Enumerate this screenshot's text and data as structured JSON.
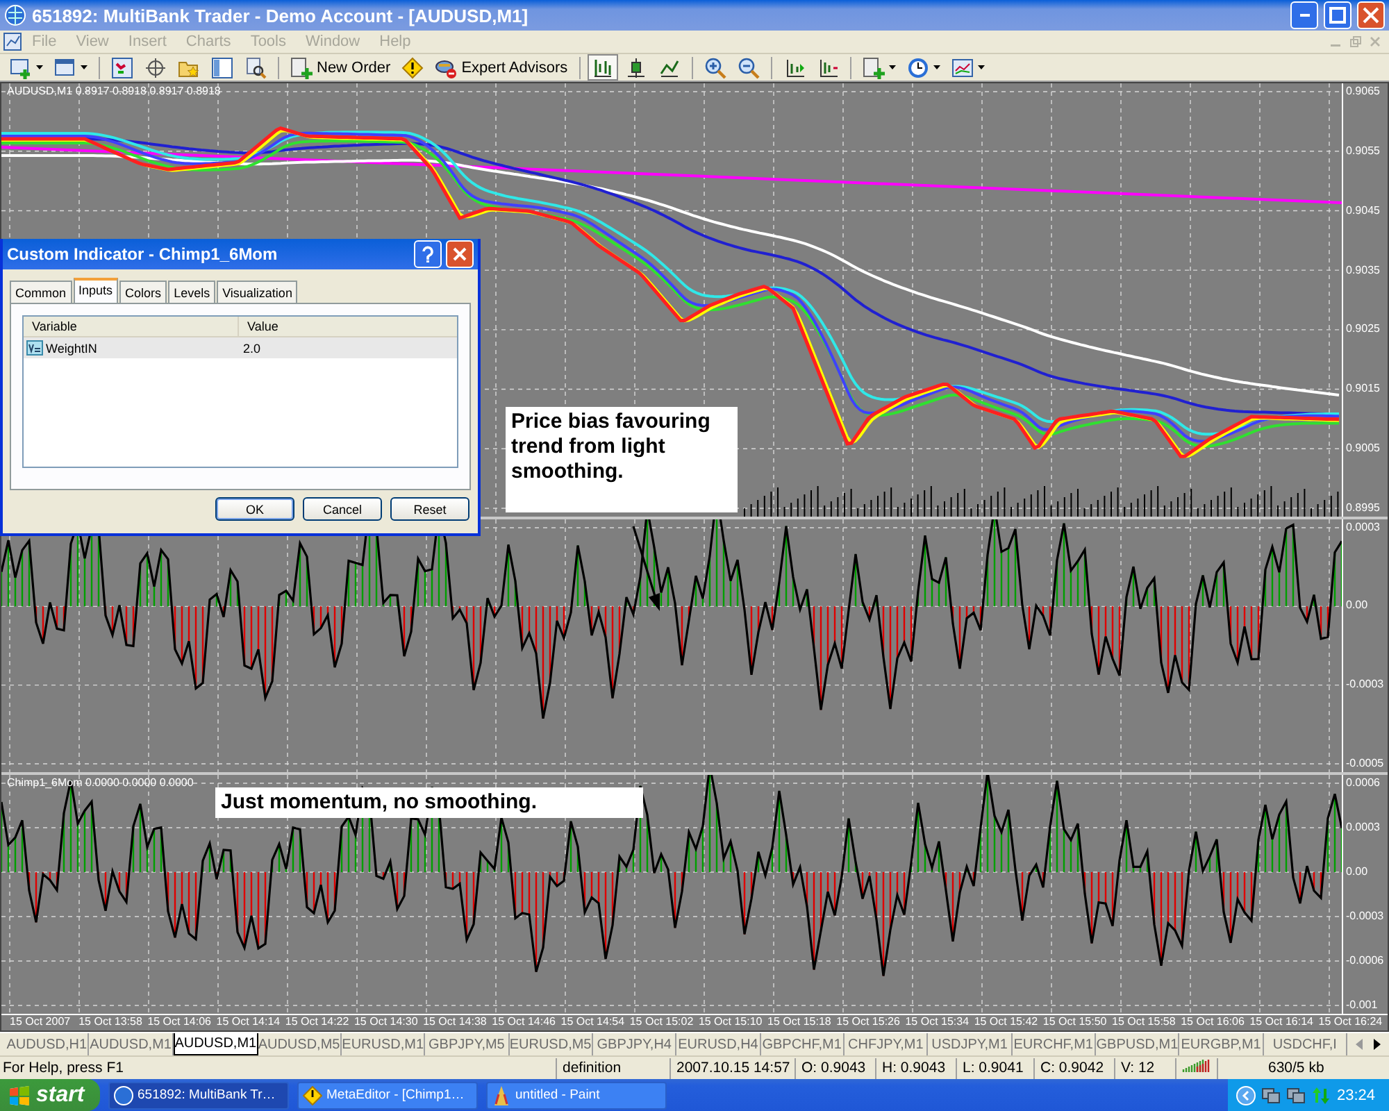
{
  "window": {
    "title": "651892: MultiBank Trader - Demo Account - [AUDUSD,M1]"
  },
  "menu": [
    {
      "label": "File",
      "disabled": true
    },
    {
      "label": "View",
      "disabled": true
    },
    {
      "label": "Insert",
      "disabled": true
    },
    {
      "label": "Charts",
      "disabled": true
    },
    {
      "label": "Tools",
      "disabled": true
    },
    {
      "label": "Window",
      "disabled": true
    },
    {
      "label": "Help",
      "disabled": true
    }
  ],
  "toolbar": [
    {
      "kind": "dropdown",
      "selected": false
    },
    {
      "kind": "dropdown",
      "selected": false
    },
    {
      "kind": "separator"
    },
    {
      "kind": "icon",
      "selected": false
    },
    {
      "kind": "icon",
      "selected": false
    },
    {
      "kind": "icon",
      "selected": false
    },
    {
      "kind": "icon",
      "selected": false
    },
    {
      "kind": "icon",
      "selected": false
    },
    {
      "kind": "separator"
    },
    {
      "kind": "labeled",
      "label": "New Order",
      "selected": false
    },
    {
      "kind": "icon",
      "selected": false
    },
    {
      "kind": "labeled",
      "label": "Expert Advisors",
      "selected": false
    },
    {
      "kind": "separator"
    },
    {
      "kind": "icon",
      "selected": true
    },
    {
      "kind": "icon",
      "selected": false
    },
    {
      "kind": "icon",
      "selected": false
    },
    {
      "kind": "separator"
    },
    {
      "kind": "icon",
      "selected": false
    },
    {
      "kind": "icon",
      "selected": false
    },
    {
      "kind": "separator"
    },
    {
      "kind": "icon",
      "selected": false
    },
    {
      "kind": "icon",
      "selected": false
    },
    {
      "kind": "separator"
    },
    {
      "kind": "dropdown",
      "selected": false
    },
    {
      "kind": "dropdown",
      "selected": false
    },
    {
      "kind": "dropdown",
      "selected": false
    }
  ],
  "price_chart": {
    "title": "AUDUSD,M1  0.8917 0.8918 0.8917 0.8918",
    "axis": [
      "0.9065",
      "0.9055",
      "0.9045",
      "0.9035",
      "0.9025",
      "0.9015",
      "0.9005",
      "0.8995"
    ],
    "annotation": "Price bias favouring trend from light smoothing."
  },
  "indicator_1": {
    "axis": [
      "0.0003",
      "0.00",
      "-0.0003",
      "-0.0005"
    ]
  },
  "indicator_2": {
    "title": "Chimp1_6Mom 0.0000 0.0000 0.0000",
    "axis": [
      "0.0006",
      "0.0003",
      "0.00",
      "-0.0003",
      "-0.0006",
      "-0.001"
    ],
    "annotation": "Just momentum, no smoothing."
  },
  "time_axis": [
    "15 Oct 2007",
    "15 Oct 13:58",
    "15 Oct 14:06",
    "15 Oct 14:14",
    "15 Oct 14:22",
    "15 Oct 14:30",
    "15 Oct 14:38",
    "15 Oct 14:46",
    "15 Oct 14:54",
    "15 Oct 15:02",
    "15 Oct 15:10",
    "15 Oct 15:18",
    "15 Oct 15:26",
    "15 Oct 15:34",
    "15 Oct 15:42",
    "15 Oct 15:50",
    "15 Oct 15:58",
    "15 Oct 16:06",
    "15 Oct 16:14",
    "15 Oct 16:24"
  ],
  "dialog": {
    "title": "Custom Indicator - Chimp1_6Mom",
    "tabs": [
      {
        "label": "Common",
        "selected": false
      },
      {
        "label": "Inputs",
        "selected": true
      },
      {
        "label": "Colors",
        "selected": false
      },
      {
        "label": "Levels",
        "selected": false
      },
      {
        "label": "Visualization",
        "selected": false
      }
    ],
    "columns": [
      "Variable",
      "Value"
    ],
    "rows": [
      {
        "variable": "WeightIN",
        "value": "2.0",
        "selected": true
      }
    ],
    "buttons": [
      {
        "label": "OK",
        "default": true
      },
      {
        "label": "Cancel",
        "default": false
      },
      {
        "label": "Reset",
        "default": false
      }
    ]
  },
  "chart_tabs": [
    {
      "label": "AUDUSD,H1",
      "selected": false
    },
    {
      "label": "AUDUSD,M1",
      "selected": false
    },
    {
      "label": "AUDUSD,M1",
      "selected": true
    },
    {
      "label": "AUDUSD,M5",
      "selected": false
    },
    {
      "label": "EURUSD,M1",
      "selected": false
    },
    {
      "label": "GBPJPY,M5",
      "selected": false
    },
    {
      "label": "EURUSD,M5",
      "selected": false
    },
    {
      "label": "GBPJPY,H4",
      "selected": false
    },
    {
      "label": "EURUSD,H4",
      "selected": false
    },
    {
      "label": "GBPCHF,M1",
      "selected": false
    },
    {
      "label": "CHFJPY,M1",
      "selected": false
    },
    {
      "label": "USDJPY,M1",
      "selected": false
    },
    {
      "label": "EURCHF,M1",
      "selected": false
    },
    {
      "label": "GBPUSD,M1",
      "selected": false
    },
    {
      "label": "EURGBP,M1",
      "selected": false
    },
    {
      "label": "USDCHF,I",
      "selected": false
    }
  ],
  "status_bar": {
    "help": "For Help, press F1",
    "fields": [
      "definition",
      "2007.10.15 14:57",
      "O: 0.9043",
      "H: 0.9043",
      "L: 0.9041",
      "C: 0.9042",
      "V: 12"
    ],
    "traffic": "630/5 kb"
  },
  "taskbar": {
    "start": "start",
    "tasks": [
      {
        "label": "651892: MultiBank Tr…",
        "active": true
      },
      {
        "label": "MetaEditor - [Chimp1…",
        "active": false
      },
      {
        "label": "untitled - Paint",
        "active": false
      }
    ],
    "clock": "23:24"
  }
}
